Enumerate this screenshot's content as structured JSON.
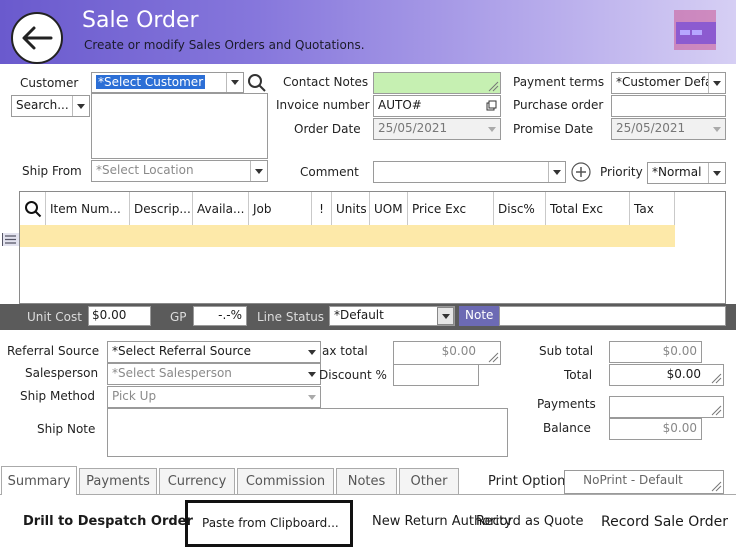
{
  "header": {
    "title": "Sale Order",
    "subtitle": "Create or modify Sales Orders and Quotations."
  },
  "form": {
    "customer_label": "Customer",
    "customer_value": "*Select Customer",
    "search_value": "Search...",
    "contact_notes_label": "Contact Notes",
    "invoice_number_label": "Invoice number",
    "invoice_number_value": "AUTO#",
    "order_date_label": "Order Date",
    "order_date_value": "25/05/2021",
    "payment_terms_label": "Payment terms",
    "payment_terms_value": "*Customer Defa",
    "purchase_order_label": "Purchase order",
    "promise_date_label": "Promise Date",
    "promise_date_value": "25/05/2021",
    "ship_from_label": "Ship From",
    "ship_from_value": "*Select Location",
    "comment_label": "Comment",
    "priority_label": "Priority",
    "priority_value": "*Normal"
  },
  "grid": {
    "columns": [
      "Item Num...",
      "Descrip...",
      "Availa...",
      "Job",
      "!",
      "Units",
      "UOM",
      "Price Exc",
      "Disc%",
      "Total Exc",
      "Tax"
    ]
  },
  "line_bar": {
    "unit_cost_label": "Unit Cost",
    "unit_cost_value": "$0.00",
    "gp_label": "GP",
    "gp_value": "-.-%",
    "line_status_label": "Line Status",
    "line_status_value": "*Default",
    "note_label": "Note"
  },
  "details": {
    "referral_label": "Referral Source",
    "referral_value": "*Select Referral Source",
    "salesperson_label": "Salesperson",
    "salesperson_value": "*Select Salesperson",
    "ship_method_label": "Ship Method",
    "ship_method_value": "Pick Up",
    "ship_note_label": "Ship Note",
    "tax_total_label": "ax total",
    "tax_total_value": "$0.00",
    "discount_label": "Discount %"
  },
  "totals": {
    "sub_total_label": "Sub total",
    "sub_total_value": "$0.00",
    "total_label": "Total",
    "total_value": "$0.00",
    "payments_label": "Payments",
    "balance_label": "Balance",
    "balance_value": "$0.00"
  },
  "tabs": [
    "Summary",
    "Payments",
    "Currency",
    "Commission",
    "Notes",
    "Other"
  ],
  "print": {
    "label": "Print Option",
    "value": "NoPrint - Default"
  },
  "actions": {
    "drill": "Drill to Despatch Order",
    "paste": "Paste from Clipboard...",
    "new_return": "New Return Authority",
    "record_quote": "Record as Quote",
    "record_order": "Record Sale Order"
  },
  "colors": {
    "header_start": "#6a5acd",
    "grid_row": "#fde9a9",
    "contact_notes": "#c6f0b2",
    "band": "#5b5b5b"
  }
}
